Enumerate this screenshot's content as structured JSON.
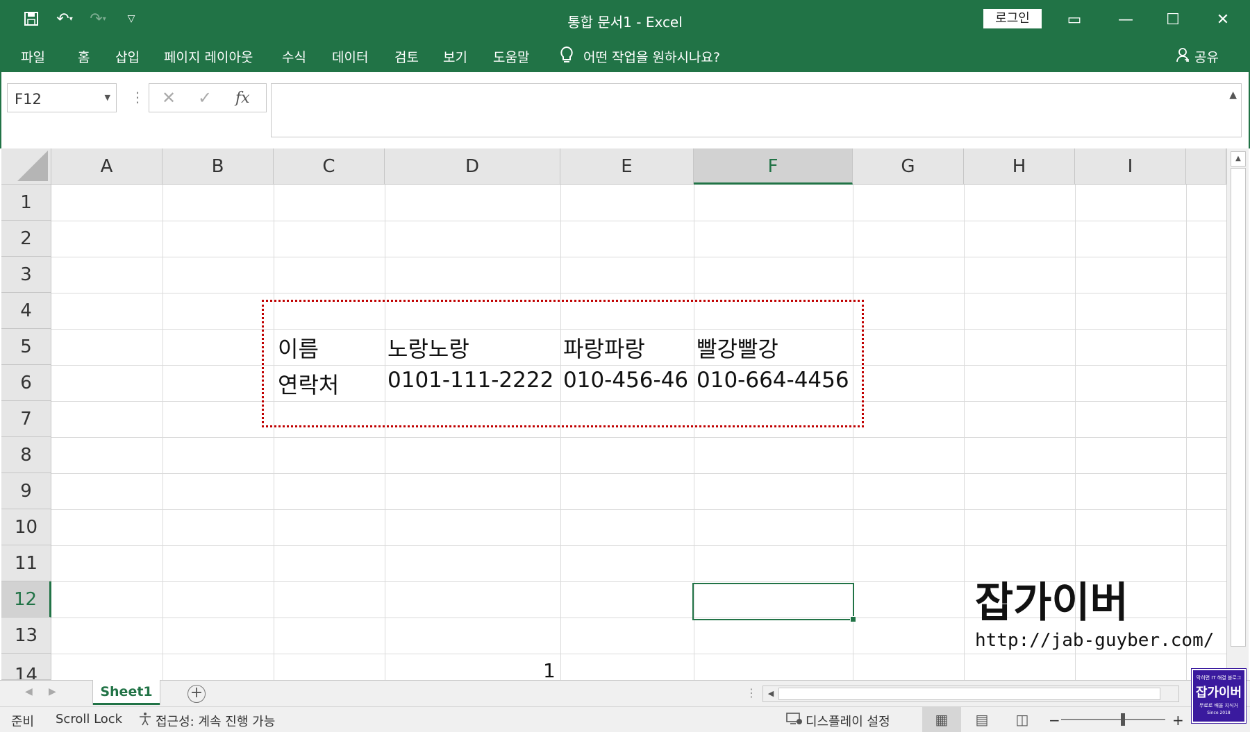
{
  "titlebar": {
    "title": "통합 문서1  -  Excel",
    "login_label": "로그인",
    "qat_icons": [
      "save-icon",
      "undo-icon",
      "redo-icon",
      "customize-icon"
    ],
    "window_buttons": {
      "ribbon_display": "▭",
      "minimize": "—",
      "maximize": "☐",
      "close": "✕"
    }
  },
  "ribbon": {
    "tabs": [
      "파일",
      "홈",
      "삽입",
      "페이지 레이아웃",
      "수식",
      "데이터",
      "검토",
      "보기",
      "도움말"
    ],
    "tell_me": "어떤 작업을 원하시나요?",
    "share": "공유"
  },
  "formula_bar": {
    "name_box": "F12",
    "formula_value": ""
  },
  "grid": {
    "columns": [
      "A",
      "B",
      "C",
      "D",
      "E",
      "F",
      "G",
      "H",
      "I"
    ],
    "selected_column": "F",
    "rows": [
      "1",
      "2",
      "3",
      "4",
      "5",
      "6",
      "7",
      "8",
      "9",
      "10",
      "11",
      "12",
      "13",
      "14"
    ],
    "selected_row": "12",
    "cells": {
      "C5": "이름",
      "D5": "노랑노랑",
      "E5": "파랑파랑",
      "F5": "빨강빨강",
      "C6": "연락처",
      "D6": "0101-111-2222",
      "E6": "010-456-46",
      "F6": "010-664-4456",
      "D14": "1"
    }
  },
  "watermark": {
    "title": "잡가이버",
    "url": "http://jab-guyber.com/"
  },
  "sheets": {
    "tabs": [
      "Sheet1"
    ],
    "active": "Sheet1"
  },
  "statusbar": {
    "ready": "준비",
    "scroll_lock": "Scroll Lock",
    "accessibility": "접근성: 계속 진행 가능",
    "display_settings": "디스플레이 설정",
    "zoom_minus": "−",
    "zoom_plus": "+"
  },
  "badge": {
    "line1": "막히면 IT 해결 블로그",
    "line2": "잡가이버",
    "line3": "무료로 배울 지식거",
    "line4": "Since 2018"
  },
  "colors": {
    "excel_green": "#217346",
    "marquee_red": "#c00000"
  }
}
